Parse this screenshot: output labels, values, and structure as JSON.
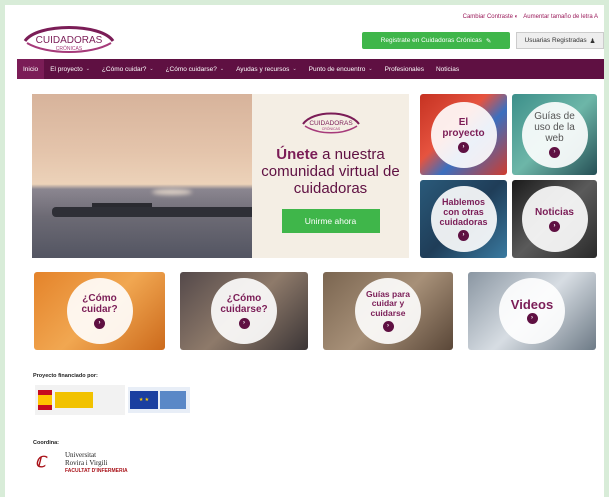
{
  "header": {
    "logo_text": "CUIDADORAS",
    "logo_sub": "CRÓNICAS",
    "top_links": [
      "Cambiar Contraste",
      "Aumentar tamaño de letra"
    ],
    "register_button": "Registrate en Cuidadoras Crónicas",
    "users_button": "Usuarias Registradas"
  },
  "nav": {
    "items": [
      {
        "label": "Inicio",
        "caret": false
      },
      {
        "label": "El proyecto",
        "caret": true
      },
      {
        "label": "¿Cómo cuidar?",
        "caret": true
      },
      {
        "label": "¿Cómo cuidarse?",
        "caret": true
      },
      {
        "label": "Ayudas y recursos",
        "caret": true
      },
      {
        "label": "Punto de encuentro",
        "caret": true
      },
      {
        "label": "Profesionales",
        "caret": false
      },
      {
        "label": "Noticias",
        "caret": false
      }
    ]
  },
  "hero": {
    "title_bold": "Únete",
    "title_rest": "a nuestra comunidad virtual de cuidadoras",
    "join_button": "Unirme ahora"
  },
  "tiles": {
    "proyecto": "El proyecto",
    "guias_web": "Guías de uso de la web",
    "hablemos": "Hablemos con otras cuidadoras",
    "noticias": "Noticias",
    "como_cuidar": "¿Cómo cuidar?",
    "como_cuidarse": "¿Cómo cuidarse?",
    "guias_cuidar": "Guías para cuidar y cuidarse",
    "videos": "Videos"
  },
  "footer": {
    "financed_label": "Proyecto financiado por:",
    "coordina_label": "Coordina:",
    "urv_line1": "Universitat",
    "urv_line2": "Rovira i Virgili",
    "urv_line3": "FACULTAT D'INFERMERIA"
  },
  "colors": {
    "brand": "#5f1042",
    "accent": "#3fb64a"
  }
}
